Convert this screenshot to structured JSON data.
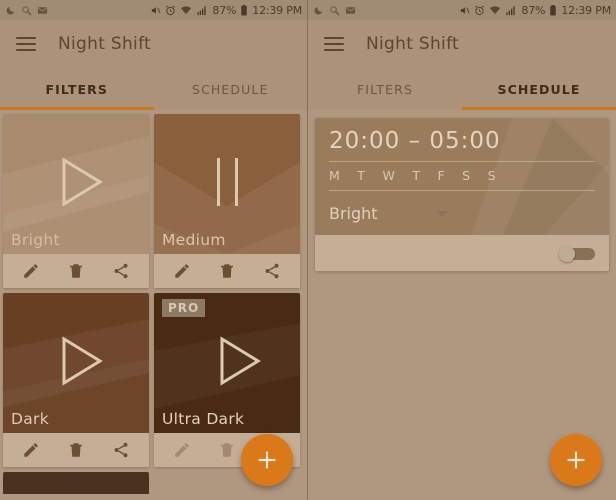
{
  "status_bar": {
    "left_icons": [
      "moon-icon",
      "search-icon",
      "envelope-icon"
    ],
    "right_icons": [
      "mute-icon",
      "alarm-icon",
      "wifi-icon",
      "signal-icon",
      "battery-icon"
    ],
    "battery": "87%",
    "time": "12:39 PM"
  },
  "app": {
    "title": "Night Shift",
    "menu_icon": "hamburger-icon",
    "accent_color": "#c97b1b",
    "fab_color": "#d9791a",
    "fab_icon": "plus-icon",
    "fab_label": "+"
  },
  "tabs": [
    {
      "label": "FILTERS"
    },
    {
      "label": "SCHEDULE"
    }
  ],
  "left_panel": {
    "active_tab": "FILTERS",
    "active_tab_index": 0,
    "filters": [
      {
        "name": "Bright",
        "glyph": "play-icon",
        "badge": null,
        "actions_enabled": true
      },
      {
        "name": "Medium",
        "glyph": "pause-icon",
        "badge": null,
        "actions_enabled": true
      },
      {
        "name": "Dark",
        "glyph": "play-icon",
        "badge": null,
        "actions_enabled": true
      },
      {
        "name": "Ultra Dark",
        "glyph": "play-icon",
        "badge": "PRO",
        "actions_enabled": false
      }
    ],
    "card_actions": [
      {
        "name": "edit",
        "icon": "pencil-icon"
      },
      {
        "name": "delete",
        "icon": "trash-icon"
      },
      {
        "name": "share",
        "icon": "share-icon"
      }
    ]
  },
  "right_panel": {
    "active_tab": "SCHEDULE",
    "active_tab_index": 1,
    "schedule": {
      "time_range": "20:00 – 05:00",
      "days": [
        "M",
        "T",
        "W",
        "T",
        "F",
        "S",
        "S"
      ],
      "filter_label": "Bright",
      "dropdown_icon": "chevron-down-icon",
      "enabled": false
    }
  }
}
